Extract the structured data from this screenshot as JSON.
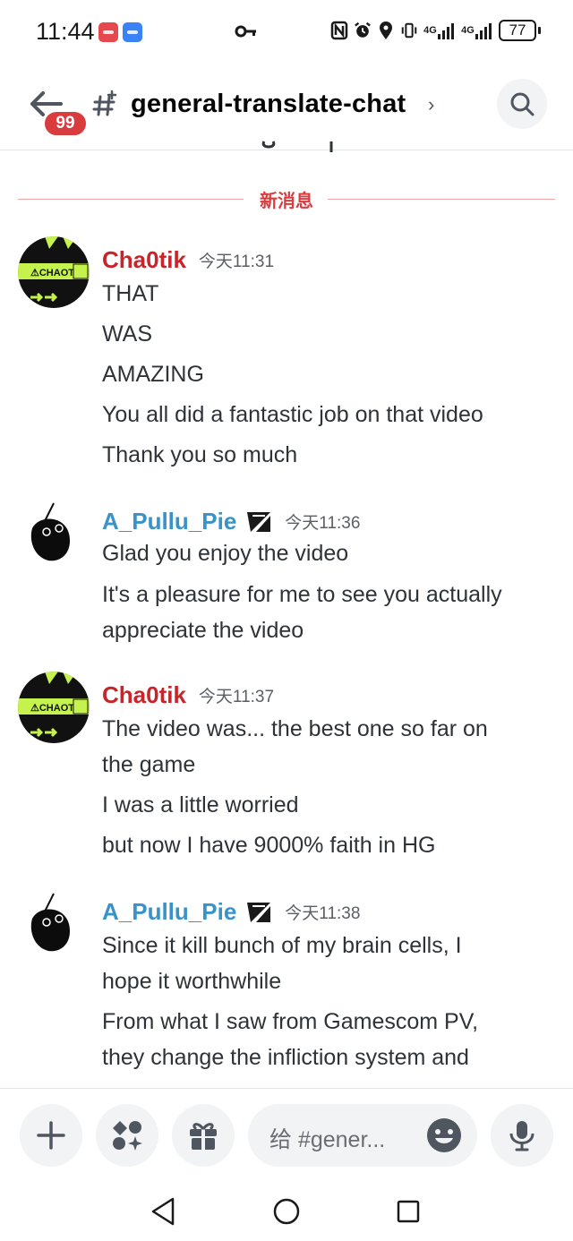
{
  "status_bar": {
    "time": "11:44",
    "network_4g_a": "4G",
    "network_4g_b": "4G",
    "battery": "77"
  },
  "header": {
    "unread_badge": "99",
    "channel_name": "general-translate-chat",
    "chevron": "›"
  },
  "divider": {
    "new_messages_label": "新消息"
  },
  "messages": [
    {
      "author": "Cha0tik",
      "timestamp": "今天11:31",
      "lines": [
        "THAT",
        "WAS",
        "AMAZING",
        "You all did a fantastic job on that video",
        "Thank you so much"
      ]
    },
    {
      "author": "A_Pullu_Pie",
      "timestamp": "今天11:36",
      "lines": [
        "Glad you enjoy the video",
        "It's a pleasure for me to see you actually",
        "appreciate the video"
      ]
    },
    {
      "author": "Cha0tik",
      "timestamp": "今天11:37",
      "lines": [
        "The video was... the best one so far on",
        "the game",
        "I was a little worried",
        "but now I have 9000% faith in HG"
      ]
    },
    {
      "author": "A_Pullu_Pie",
      "timestamp": "今天11:38",
      "lines": [
        "Since it kill bunch of my brain cells, I",
        "hope it worthwhile",
        "From what I saw from Gamescom PV,",
        "they change the infliction system and"
      ]
    }
  ],
  "composer": {
    "placeholder": "给 #gener..."
  },
  "colors": {
    "author_red": "#c8252b",
    "author_blue": "#3a93c8",
    "badge_red": "#d83c3e",
    "divider_red": "#d83c3e"
  },
  "icons": {
    "back": "back-arrow-icon",
    "channel": "thread-hash-icon",
    "search": "search-icon",
    "plus": "plus-icon",
    "apps": "apps-icon",
    "gift": "gift-icon",
    "emoji": "emoji-icon",
    "mic": "microphone-icon",
    "nav_back": "nav-back-icon",
    "nav_home": "nav-home-icon",
    "nav_recents": "nav-recents-icon"
  }
}
